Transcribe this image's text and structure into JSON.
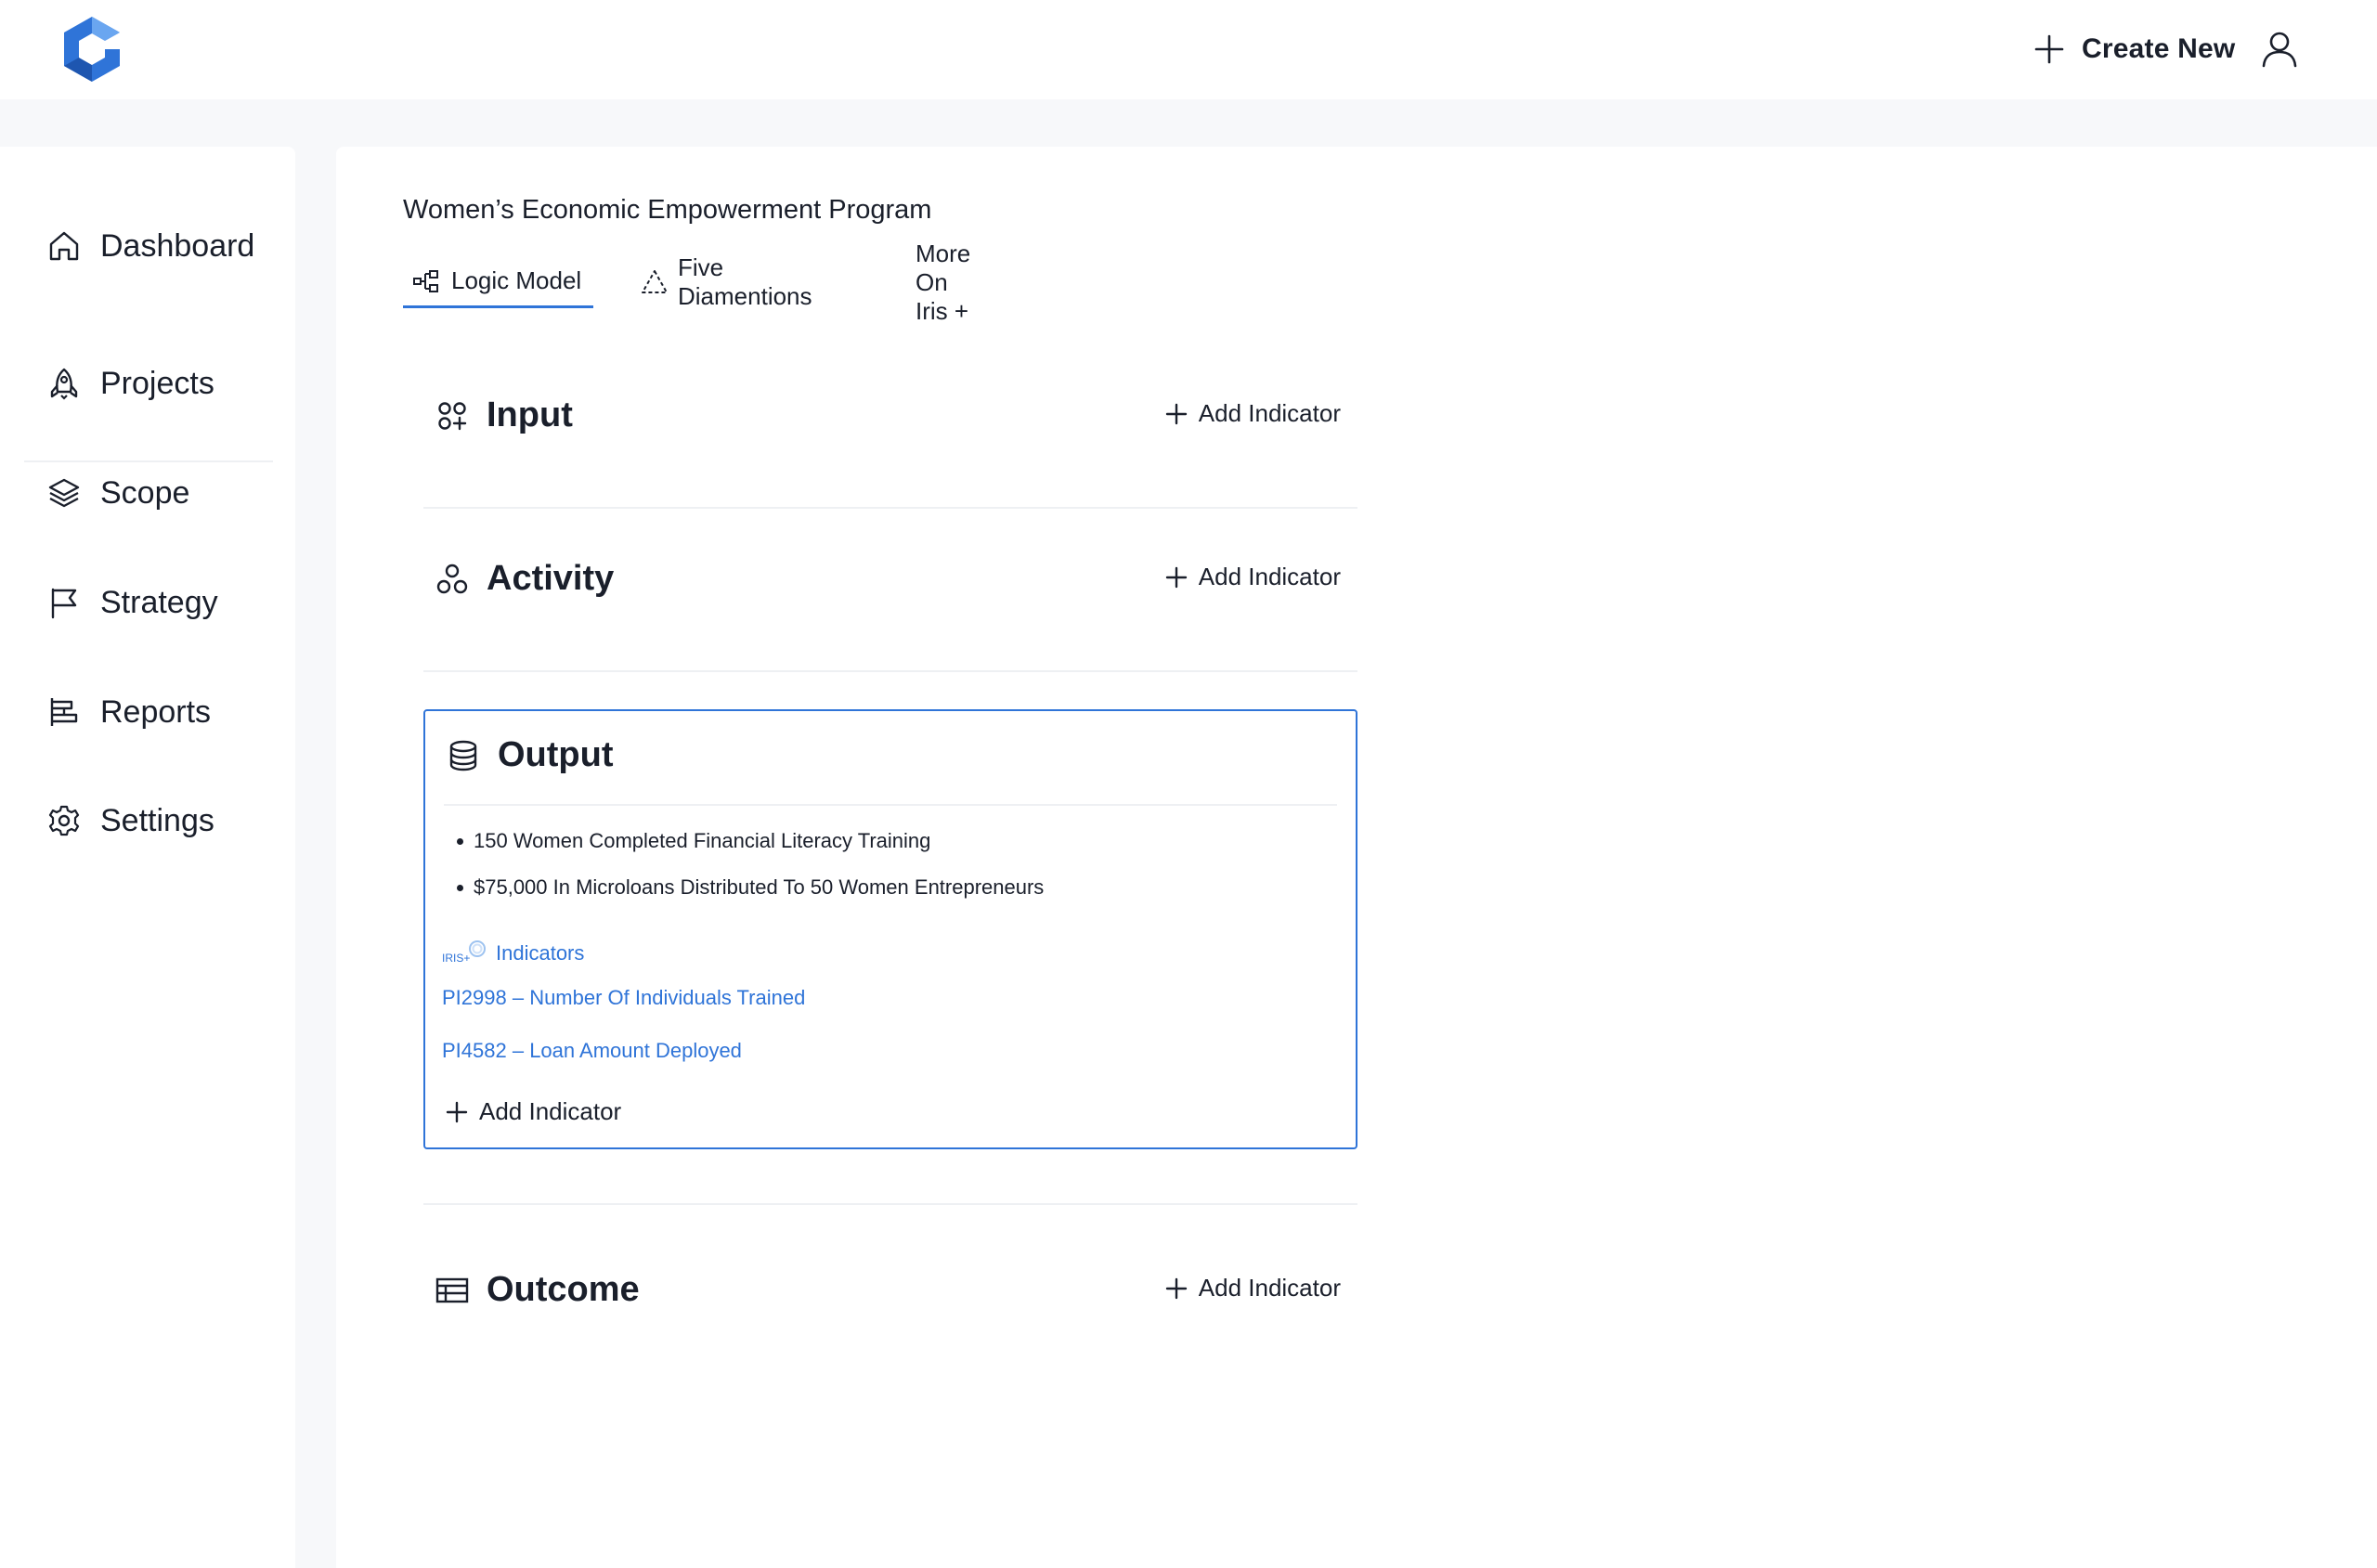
{
  "header": {
    "create_new_label": "Create New",
    "icons": [
      "app-logo",
      "plus-icon",
      "user-icon"
    ]
  },
  "sidebar": {
    "items": [
      {
        "label": "Dashboard",
        "icon": "home-icon"
      },
      {
        "label": "Projects",
        "icon": "rocket-icon"
      },
      {
        "label": "Scope",
        "icon": "layers-icon"
      },
      {
        "label": "Strategy",
        "icon": "flag-icon"
      },
      {
        "label": "Reports",
        "icon": "reports-icon"
      },
      {
        "label": "Settings",
        "icon": "gear-icon"
      }
    ]
  },
  "main": {
    "program_title": "Women’s Economic Empowerment Program",
    "tabs": [
      {
        "label": "Logic Model",
        "icon": "logic-model-icon",
        "active": true
      },
      {
        "label": "Five Diamentions",
        "icon": "triangle-icon",
        "active": false
      },
      {
        "label": "More On Iris +",
        "icon": "",
        "active": false
      }
    ],
    "add_indicator_label": "Add Indicator",
    "sections": {
      "input": {
        "name": "Input",
        "icon": "input-icon"
      },
      "activity": {
        "name": "Activity",
        "icon": "activity-icon"
      },
      "output": {
        "name": "Output",
        "icon": "database-icon",
        "bullets": [
          "150 Women Completed Financial Literacy Training",
          "$75,000 In Microloans Distributed To 50 Women Entrepreneurs"
        ],
        "iris_logo_text": "IRIS+",
        "indicators_label": "Indicators",
        "indicators": [
          "PI2998 – Number Of Individuals Trained",
          "PI4582 – Loan Amount Deployed"
        ]
      },
      "outcome": {
        "name": "Outcome",
        "icon": "table-icon"
      }
    }
  },
  "colors": {
    "accent": "#2f74d8",
    "text": "#1a1f2b",
    "page_bg": "#f7f8fa",
    "divider": "#eef0f3"
  }
}
